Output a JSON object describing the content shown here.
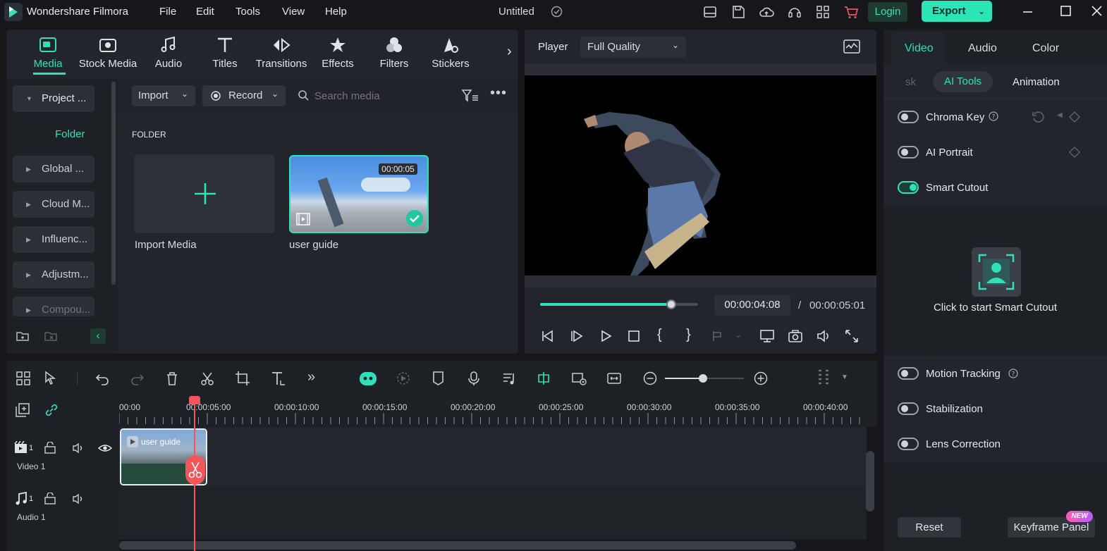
{
  "app": {
    "name": "Wondershare Filmora",
    "project_title": "Untitled",
    "menu": [
      "File",
      "Edit",
      "Tools",
      "View",
      "Help"
    ],
    "login_label": "Login",
    "export_label": "Export"
  },
  "media_toolbar": {
    "tabs": [
      {
        "label": "Media",
        "icon": "media-icon",
        "active": true
      },
      {
        "label": "Stock Media",
        "icon": "stock-media-icon"
      },
      {
        "label": "Audio",
        "icon": "music-note-icon"
      },
      {
        "label": "Titles",
        "icon": "titles-icon"
      },
      {
        "label": "Transitions",
        "icon": "transitions-icon"
      },
      {
        "label": "Effects",
        "icon": "effects-icon"
      },
      {
        "label": "Filters",
        "icon": "filters-icon"
      },
      {
        "label": "Stickers",
        "icon": "stickers-icon"
      }
    ]
  },
  "sidebar": {
    "items": [
      "Project ...",
      "Folder",
      "Global ...",
      "Cloud M...",
      "Influenc...",
      "Adjustm...",
      "Compou..."
    ]
  },
  "media": {
    "import_label": "Import",
    "record_label": "Record",
    "search_placeholder": "Search media",
    "folder_heading": "FOLDER",
    "cards": [
      {
        "label": "Import Media"
      },
      {
        "label": "user guide",
        "duration": "00:00:05"
      }
    ]
  },
  "player": {
    "label": "Player",
    "quality": "Full Quality",
    "current_time": "00:00:04:08",
    "separator": "/",
    "total_time": "00:00:05:01",
    "progress": 0.83
  },
  "right_panel": {
    "tabs": [
      "Video",
      "Audio",
      "Color"
    ],
    "subtabs": [
      "sk",
      "AI Tools",
      "Animation"
    ],
    "options_top": [
      {
        "label": "Chroma Key",
        "on": false
      },
      {
        "label": "AI Portrait",
        "on": false
      },
      {
        "label": "Smart Cutout",
        "on": true
      }
    ],
    "cutout_hint": "Click to start Smart Cutout",
    "options_bottom": [
      {
        "label": "Motion Tracking",
        "on": false
      },
      {
        "label": "Stabilization",
        "on": false
      },
      {
        "label": "Lens Correction",
        "on": false
      }
    ],
    "reset_label": "Reset",
    "keyframe_label": "Keyframe Panel",
    "new_badge": "NEW"
  },
  "timeline": {
    "ruler": [
      "00:00",
      "00:00:05:00",
      "00:00:10:00",
      "00:00:15:00",
      "00:00:20:00",
      "00:00:25:00",
      "00:00:30:00",
      "00:00:35:00",
      "00:00:40:00"
    ],
    "tracks": [
      {
        "label": "Video 1",
        "index": "1"
      },
      {
        "label": "Audio 1",
        "index": "1"
      }
    ],
    "clip_label": "user guide"
  },
  "colors": {
    "accent": "#2fe0b8",
    "playhead": "#f2555a",
    "panel": "#22252b",
    "bg": "#15171b"
  }
}
